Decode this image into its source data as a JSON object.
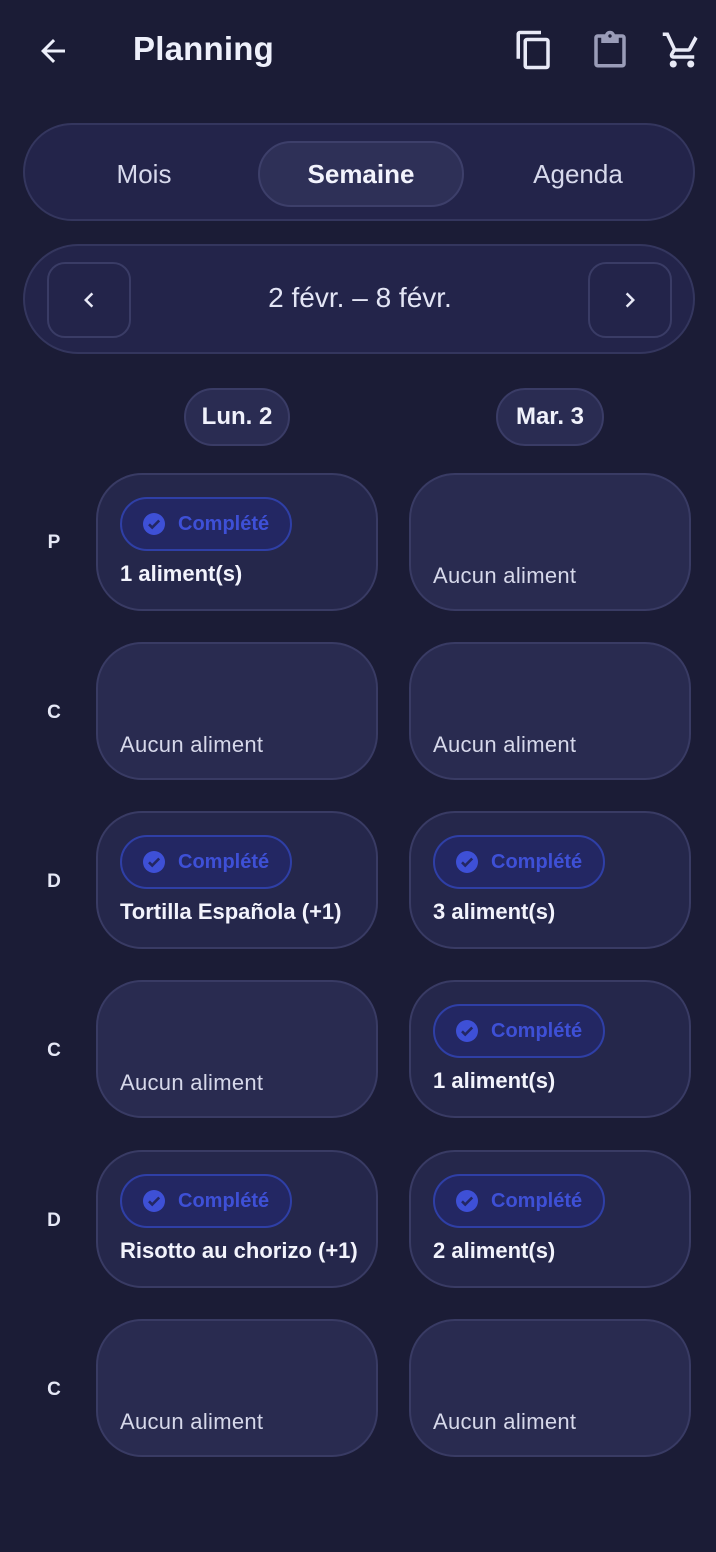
{
  "appbar": {
    "title": "Planning",
    "icons": [
      "arrow-back-icon",
      "copy-icon",
      "clipboard-icon",
      "cart-icon"
    ]
  },
  "tabs": [
    {
      "label": "Mois",
      "selected": false
    },
    {
      "label": "Semaine",
      "selected": true
    },
    {
      "label": "Agenda",
      "selected": false
    }
  ],
  "week": {
    "label": "2 févr. – 8 févr.",
    "icons": [
      "chevron-left-icon",
      "chevron-right-icon"
    ]
  },
  "days": [
    "Lun. 2",
    "Mar. 3"
  ],
  "rows": [
    "P",
    "C",
    "D",
    "C",
    "D",
    "C"
  ],
  "cells": [
    [
      {
        "status": "Complété",
        "text": "1 aliment(s)"
      },
      {
        "status": "",
        "text": "Aucun aliment"
      }
    ],
    [
      {
        "status": "",
        "text": "Aucun aliment"
      },
      {
        "status": "",
        "text": "Aucun aliment"
      }
    ],
    [
      {
        "status": "Complété",
        "text": "Tortilla Española (+1)"
      },
      {
        "status": "Complété",
        "text": "3 aliment(s)"
      }
    ],
    [
      {
        "status": "",
        "text": "Aucun aliment"
      },
      {
        "status": "Complété",
        "text": "1 aliment(s)"
      }
    ],
    [
      {
        "status": "Complété",
        "text": "Risotto au chorizo (+1)"
      },
      {
        "status": "Complété",
        "text": "2 aliment(s)"
      }
    ],
    [
      {
        "status": "",
        "text": "Aucun aliment"
      },
      {
        "status": "",
        "text": "Aucun aliment"
      }
    ]
  ],
  "colors": {
    "background": "#1b1c36",
    "badge_text": "#3e50d6",
    "badge_border": "#2f3fa6"
  }
}
